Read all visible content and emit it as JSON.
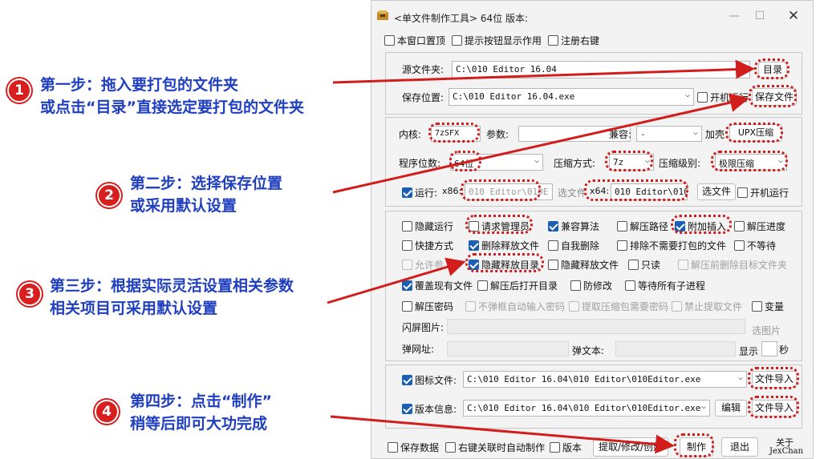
{
  "window": {
    "title": "<单文件制作工具> 64位 版本:",
    "minimize": "—",
    "maximize": "☐",
    "close": "✕"
  },
  "top_options": [
    {
      "label": "本窗口置顶",
      "checked": false
    },
    {
      "label": "提示按钮显示作用",
      "checked": false
    },
    {
      "label": "注册右键",
      "checked": false
    }
  ],
  "files": {
    "source_label": "源文件夹:",
    "source_value": "C:\\010 Editor 16.04",
    "dir_button": "目录",
    "save_label": "保存位置:",
    "save_value": "C:\\010 Editor 16.04.exe",
    "autostart_label": "开机运行",
    "save_button": "保存文件"
  },
  "core": {
    "kernel_label": "内核:",
    "kernel_value": "7zSFX",
    "params_label": "参数:",
    "params_value": "",
    "mix_label": "兼容:",
    "mix_value": "-",
    "shell_label": "加壳",
    "shell_value": "UPX压缩",
    "bits_label": "程序位数:",
    "bits_value": "64位",
    "compress_label": "压缩方式:",
    "compress_value": "7z",
    "level_label": "压缩级别:",
    "level_value": "极限压缩",
    "run_label": "运行:",
    "x86_label": "x86:",
    "x86_value": "010 Editor\\010E",
    "choose_label": "选文件",
    "x64_label": "x64:",
    "x64_value": "010 Editor\\010",
    "choose_button": "选文件",
    "autostart2_label": "开机运行"
  },
  "options_rows": [
    [
      {
        "label": "隐藏运行",
        "checked": false
      },
      {
        "label": "请求管理员",
        "checked": false
      },
      {
        "label": "兼容算法",
        "checked": true
      },
      {
        "label": "解压路径",
        "checked": false
      },
      {
        "label": "附加插入",
        "checked": true
      },
      {
        "label": "解压进度",
        "checked": false
      }
    ],
    [
      {
        "label": "快捷方式",
        "checked": false
      },
      {
        "label": "删除释放文件",
        "checked": true
      },
      {
        "label": "自我删除",
        "checked": false
      },
      {
        "label": "排除不需要打包的文件",
        "checked": false
      },
      {
        "label": "不等待",
        "checked": false
      }
    ],
    [
      {
        "label": "允许参",
        "checked": false,
        "disabled": true
      },
      {
        "label": "隐藏释放目录",
        "checked": true
      },
      {
        "label": "隐藏释放文件",
        "checked": false
      },
      {
        "label": "只读",
        "checked": false
      },
      {
        "label": "解压前删除目标文件夹",
        "checked": false,
        "disabled": true
      }
    ],
    [
      {
        "label": "覆盖现有文件",
        "checked": true
      },
      {
        "label": "解压后打开目录",
        "checked": false
      },
      {
        "label": "防修改",
        "checked": false
      },
      {
        "label": "等待所有子进程",
        "checked": false
      }
    ],
    [
      {
        "label": "解压密码",
        "checked": false
      },
      {
        "label": "不弹框自动输入密码",
        "checked": false,
        "disabled": true
      },
      {
        "label": "提取压缩包需要密码",
        "checked": false,
        "disabled": true
      },
      {
        "label": "禁止提取文件",
        "checked": false,
        "disabled": true
      },
      {
        "label": "变量",
        "checked": false
      }
    ]
  ],
  "splash": {
    "label": "闪屏图片:",
    "choose": "选图片",
    "url_label": "弹网址:",
    "text_label": "弹文本:",
    "show_label": "显示",
    "seconds_label": "秒"
  },
  "icon": {
    "label": "图标文件:",
    "value": "C:\\010 Editor 16.04\\010 Editor\\010Editor.exe",
    "import": "文件导入"
  },
  "version": {
    "label": "版本信息:",
    "value": "C:\\010 Editor 16.04\\010 Editor\\010Editor.exe",
    "edit": "编辑",
    "import": "文件导入"
  },
  "bottom": {
    "save_data": "保存数据",
    "right_click": "右键关联时自动制作",
    "version": "版本",
    "extract": "提取/修改/创建",
    "make": "制作",
    "exit": "退出",
    "about": "关于",
    "author": "JexChan"
  },
  "steps": [
    {
      "num": "1",
      "line1": "第一步：拖入要打包的文件夹",
      "line2": "或点击“目录”直接选定要打包的文件夹"
    },
    {
      "num": "2",
      "line1": "第二步：选择保存位置",
      "line2": "或采用默认设置"
    },
    {
      "num": "3",
      "line1": "第三步：根据实际灵活设置相关参数",
      "line2": "相关项目可采用默认设置"
    },
    {
      "num": "4",
      "line1": "第四步：点击“制作”",
      "line2": "稍等后即可大功完成"
    }
  ],
  "colors": {
    "annotation_red": "#d21d1d",
    "annotation_text_blue": "#1f3fbf",
    "checkbox_blue": "#1a5fb4"
  }
}
